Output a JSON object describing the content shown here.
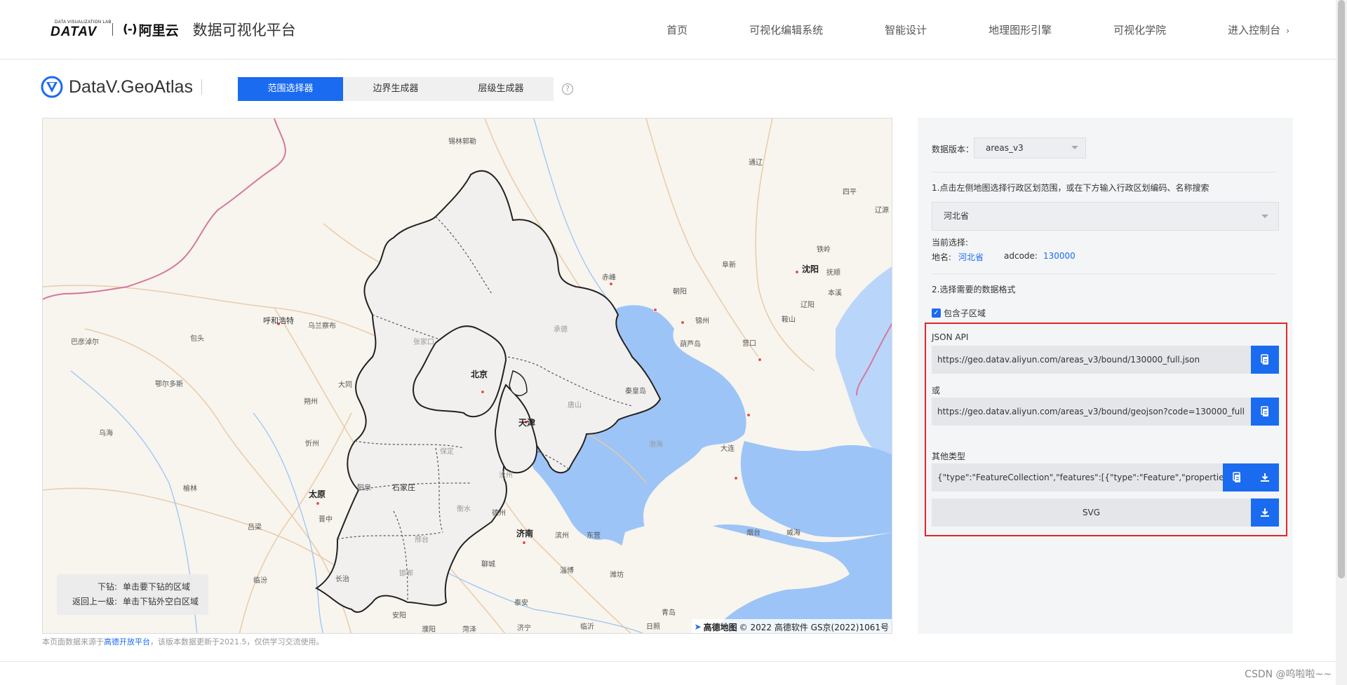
{
  "topnav": {
    "logo_tiny": "DATA VISUALIZATION LAB",
    "logo_big": "DATAV",
    "aliyun_mark": "(-)",
    "aliyun_text": "阿里云",
    "platform_title": "数据可视化平台",
    "links": [
      "首页",
      "可视化编辑系统",
      "智能设计",
      "地理图形引擎",
      "可视化学院",
      "进入控制台"
    ]
  },
  "product": {
    "name": "DataV.GeoAtlas",
    "tabs": [
      "范围选择器",
      "边界生成器",
      "层级生成器"
    ],
    "active_tab": "范围选择器",
    "help": "?"
  },
  "map": {
    "labels": {
      "beijing": "北京",
      "tianjin": "天津",
      "shijiazhuang": "石家庄",
      "taiyuan": "太原",
      "jinan": "济南",
      "huhehaote": "呼和浩特",
      "shenyang": "沈阳",
      "bohai": "渤海",
      "zhangjiakou": "张家口",
      "chengde": "承德",
      "baoding": "保定",
      "tangshan": "唐山",
      "cangzhou": "沧州",
      "hengshui": "衡水",
      "xingtai": "邢台",
      "handan": "邯郸",
      "qinhuangdao": "秦皇岛",
      "chifeng": "赤峰",
      "tongliao": "通辽",
      "fuxin": "阜新",
      "jinzhou": "锦州",
      "anshan": "鞍山",
      "liaoyang": "辽阳",
      "dalian": "大连",
      "yingkou": "营口",
      "huludao": "葫芦岛",
      "chaoyang": "朝阳",
      "datong": "大同",
      "shuozhou": "朔州",
      "xinzhou": "忻州",
      "yangquan": "阳泉",
      "jinzhong": "晋中",
      "lvliang": "吕梁",
      "baotou": "包头",
      "wulanchabu": "乌兰察布",
      "dezhou": "德州",
      "binzhou": "滨州",
      "dongying": "东营",
      "zibo": "淄博",
      "weifang": "潍坊",
      "liaocheng": "聊城",
      "taian": "泰安",
      "yantai": "烟台",
      "weihai": "威海",
      "qingdao": "青岛",
      "ordos": "鄂尔多斯",
      "yulin": "榆林",
      "tieling": "铁岭",
      "fushun": "抚顺",
      "benxi": "本溪",
      "siping": "四平",
      "liaoyuan": "辽源",
      "linfen": "临汾",
      "changzhi": "长治",
      "anyang": "安阳",
      "puyang": "濮阳",
      "heze": "菏泽",
      "jining": "济宁",
      "linyi": "临沂",
      "rizhao": "日照",
      "xilinguole": "锡林郭勒",
      "wuhai": "乌海",
      "bayannaoer": "巴彦淖尔"
    },
    "hint": {
      "drill_key": "下钻:",
      "drill_val": "单击要下钻的区域",
      "up_key": "返回上一级:",
      "up_val": "单击下钻外空白区域"
    },
    "attribution": {
      "logo": "高德地图",
      "text": "© 2022 高德软件 GS京(2022)1061号"
    }
  },
  "footnote": {
    "prefix": "本页面数据来源于",
    "link": "高德开放平台",
    "suffix": "，该版本数据更新于2021.5，仅供学习交流使用。"
  },
  "panel": {
    "version_label": "数据版本：",
    "version_value": "areas_v3",
    "step1": "1.点击左侧地图选择行政区划范围，或在下方输入行政区划编码、名称搜索",
    "region_value": "河北省",
    "current_label": "当前选择:",
    "name_label": "地名:",
    "name_value": "河北省",
    "adcode_label": "adcode:",
    "adcode_value": "130000",
    "step2": "2.选择需要的数据格式",
    "include_children": "包含子区域",
    "json_api_label": "JSON API",
    "json_api_url": "https://geo.datav.aliyun.com/areas_v3/bound/130000_full.json",
    "or_label": "或",
    "geojson_url": "https://geo.datav.aliyun.com/areas_v3/bound/geojson?code=130000_full",
    "other_label": "其他类型",
    "other_value": "{\"type\":\"FeatureCollection\",\"features\":[{\"type\":\"Feature\",\"properties\":{\"a",
    "svg_label": "SVG"
  },
  "watermark": "CSDN @呜啦啦~~",
  "colors": {
    "accent": "#1a6bf0",
    "highlight_outline": "#e0262b",
    "sea": "#9cc4f7"
  }
}
